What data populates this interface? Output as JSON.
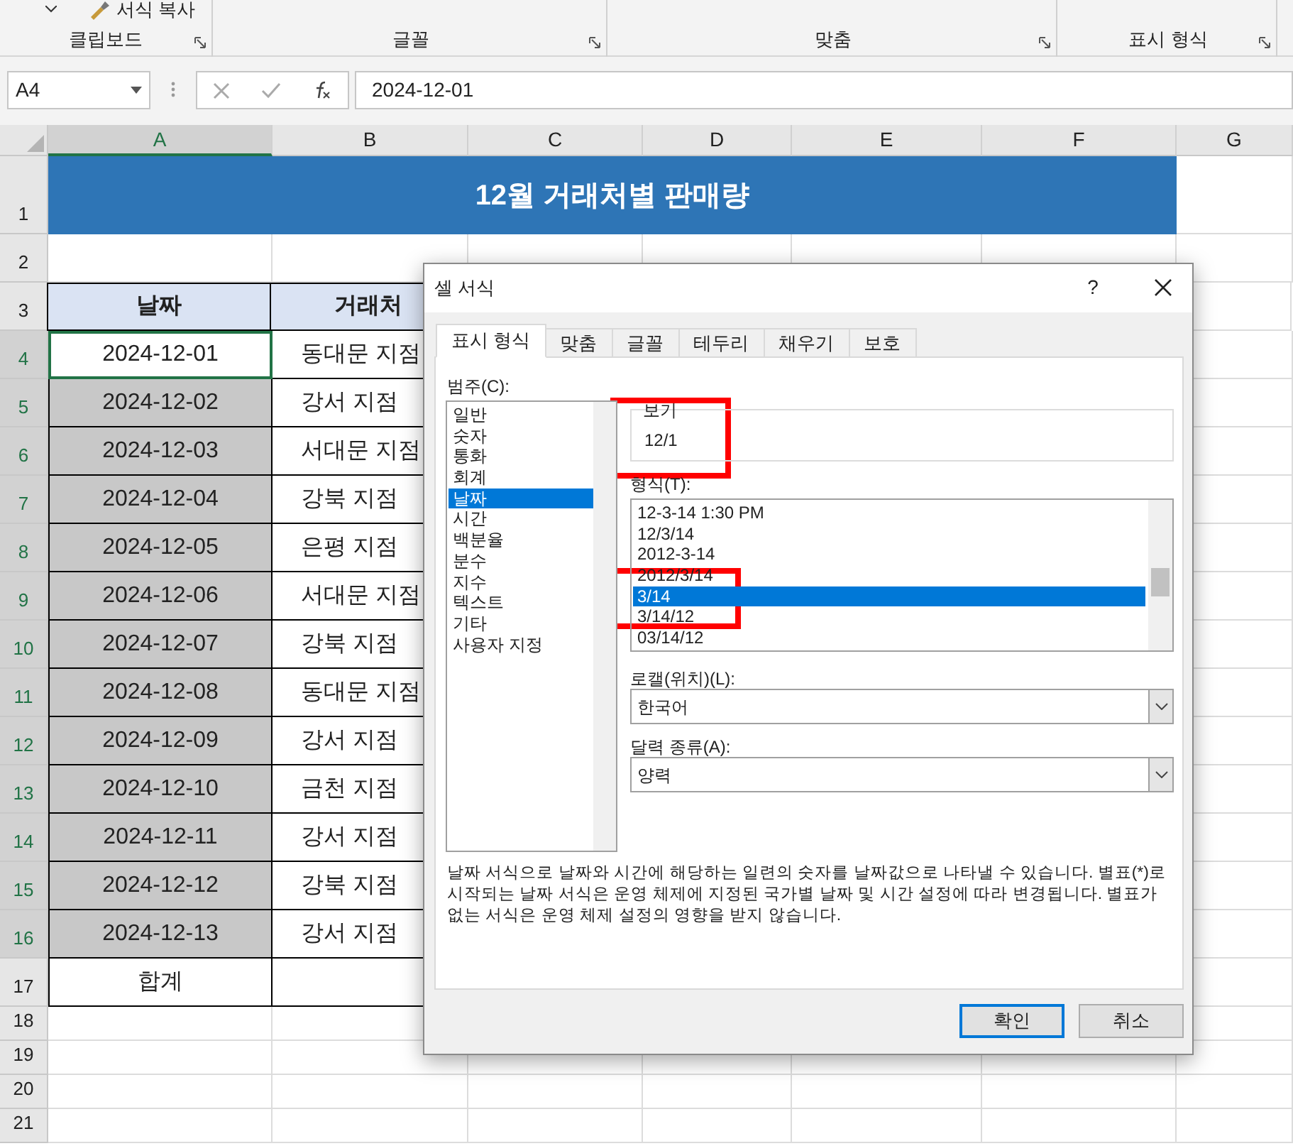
{
  "ribbon": {
    "top_text": "서식 복사",
    "groups": [
      {
        "label": "클립보드"
      },
      {
        "label": "글꼴"
      },
      {
        "label": "맞춤"
      },
      {
        "label": "표시 형식"
      }
    ]
  },
  "formula_bar": {
    "name_box": "A4",
    "formula": "2024-12-01"
  },
  "columns": [
    {
      "label": "A",
      "selected": true
    },
    {
      "label": "B",
      "selected": false
    },
    {
      "label": "C",
      "selected": false
    },
    {
      "label": "D",
      "selected": false
    },
    {
      "label": "E",
      "selected": false
    },
    {
      "label": "F",
      "selected": false
    },
    {
      "label": "G",
      "selected": false
    }
  ],
  "row_numbers": [
    {
      "label": "1",
      "selected": false
    },
    {
      "label": "2",
      "selected": false
    },
    {
      "label": "3",
      "selected": false
    },
    {
      "label": "4",
      "selected": true
    },
    {
      "label": "5",
      "selected": true
    },
    {
      "label": "6",
      "selected": true
    },
    {
      "label": "7",
      "selected": true
    },
    {
      "label": "8",
      "selected": true
    },
    {
      "label": "9",
      "selected": true
    },
    {
      "label": "10",
      "selected": true
    },
    {
      "label": "11",
      "selected": true
    },
    {
      "label": "12",
      "selected": true
    },
    {
      "label": "13",
      "selected": true
    },
    {
      "label": "14",
      "selected": true
    },
    {
      "label": "15",
      "selected": true
    },
    {
      "label": "16",
      "selected": true
    },
    {
      "label": "17",
      "selected": false
    },
    {
      "label": "18",
      "selected": false
    },
    {
      "label": "19",
      "selected": false
    },
    {
      "label": "20",
      "selected": false
    },
    {
      "label": "21",
      "selected": false
    }
  ],
  "sheet": {
    "title": "12월 거래처별 판매량",
    "headers": [
      "날짜",
      "거래처"
    ],
    "rows": [
      {
        "date": "2024-12-01",
        "branch": "동대문 지점",
        "selected": false,
        "active": true
      },
      {
        "date": "2024-12-02",
        "branch": "강서 지점",
        "selected": true,
        "active": false
      },
      {
        "date": "2024-12-03",
        "branch": "서대문 지점",
        "selected": true,
        "active": false
      },
      {
        "date": "2024-12-04",
        "branch": "강북 지점",
        "selected": true,
        "active": false
      },
      {
        "date": "2024-12-05",
        "branch": "은평 지점",
        "selected": true,
        "active": false
      },
      {
        "date": "2024-12-06",
        "branch": "서대문 지점",
        "selected": true,
        "active": false
      },
      {
        "date": "2024-12-07",
        "branch": "강북 지점",
        "selected": true,
        "active": false
      },
      {
        "date": "2024-12-08",
        "branch": "동대문 지점",
        "selected": true,
        "active": false
      },
      {
        "date": "2024-12-09",
        "branch": "강서 지점",
        "selected": true,
        "active": false
      },
      {
        "date": "2024-12-10",
        "branch": "금천 지점",
        "selected": true,
        "active": false
      },
      {
        "date": "2024-12-11",
        "branch": "강서  지점",
        "selected": true,
        "active": false
      },
      {
        "date": "2024-12-12",
        "branch": "강북 지점",
        "selected": true,
        "active": false
      },
      {
        "date": "2024-12-13",
        "branch": "강서 지점",
        "selected": true,
        "active": false
      }
    ],
    "total_label": "합계"
  },
  "dialog": {
    "title": "셀 서식",
    "help": "?",
    "tabs": [
      {
        "label": "표시 형식",
        "selected": true
      },
      {
        "label": "맞춤",
        "selected": false
      },
      {
        "label": "글꼴",
        "selected": false
      },
      {
        "label": "테두리",
        "selected": false
      },
      {
        "label": "채우기",
        "selected": false
      },
      {
        "label": "보호",
        "selected": false
      }
    ],
    "category_label": "범주(C):",
    "categories": [
      {
        "label": "일반",
        "selected": false
      },
      {
        "label": "숫자",
        "selected": false
      },
      {
        "label": "통화",
        "selected": false
      },
      {
        "label": "회계",
        "selected": false
      },
      {
        "label": "날짜",
        "selected": true
      },
      {
        "label": "시간",
        "selected": false
      },
      {
        "label": "백분율",
        "selected": false
      },
      {
        "label": "분수",
        "selected": false
      },
      {
        "label": "지수",
        "selected": false
      },
      {
        "label": "텍스트",
        "selected": false
      },
      {
        "label": "기타",
        "selected": false
      },
      {
        "label": "사용자 지정",
        "selected": false
      }
    ],
    "preview_label": "보기",
    "preview_value": "12/1",
    "format_label": "형식(T):",
    "formats": [
      {
        "label": "12-3-14 1:30 PM",
        "selected": false
      },
      {
        "label": "12/3/14",
        "selected": false
      },
      {
        "label": "2012-3-14",
        "selected": false
      },
      {
        "label": "2012/3/14",
        "selected": false
      },
      {
        "label": "3/14",
        "selected": true
      },
      {
        "label": "3/14/12",
        "selected": false
      },
      {
        "label": "03/14/12",
        "selected": false
      }
    ],
    "locale_label": "로캘(위치)(L):",
    "locale_value": "한국어",
    "calendar_label": "달력 종류(A):",
    "calendar_value": "양력",
    "description": "날짜 서식으로 날짜와 시간에 해당하는 일련의 숫자를 날짜값으로 나타낼 수 있습니다. 별표(*)로 시작되는 날짜 서식은 운영 체제에 지정된 국가별 날짜 및 시간 설정에 따라 변경됩니다. 별표가 없는 서식은 운영 체제 설정의 영향을 받지 않습니다.",
    "buttons": [
      {
        "label": "확인",
        "kind": "primary"
      },
      {
        "label": "취소",
        "kind": "normal"
      }
    ],
    "preview_highlighted": true,
    "format_highlighted": true
  }
}
